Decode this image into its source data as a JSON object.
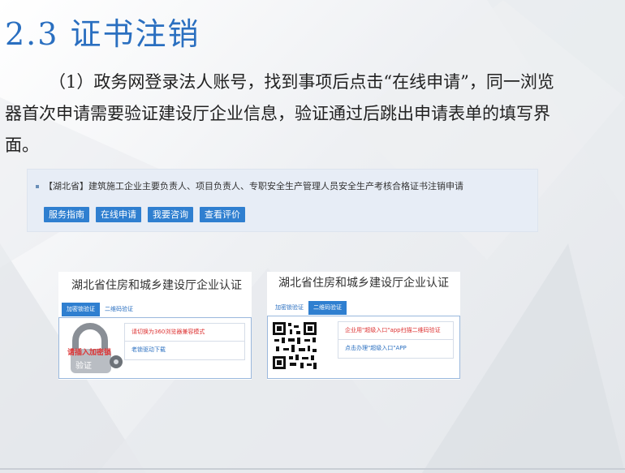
{
  "slide": {
    "title": "2.3 证书注销",
    "paragraph_indent_text": "（1）政务网登录法人账号，找到事项后点击“在线申请",
    "paragraph_rest": "”，同一浏览器首次申请需要验证建设厅企业信息，验证通过后跳出申请表单的填写界面。"
  },
  "panel": {
    "item_title": "【湖北省】建筑施工企业主要负责人、项目负责人、专职安全生产管理人员安全生产考核合格证书注销申请",
    "buttons": [
      "服务指南",
      "在线申请",
      "我要咨询",
      "查看评价"
    ]
  },
  "card_left": {
    "title": "湖北省住房和城乡建设厅企业认证",
    "tabs": [
      "加密锁验证",
      "二维码验证"
    ],
    "active_tab": 0,
    "lock_text_top": "请插入加密锁",
    "lock_text_bottom": "验证",
    "options": [
      "请切换为360浏览器兼容模式",
      "老锁驱动下载"
    ]
  },
  "card_right": {
    "title": "湖北省住房和城乡建设厅企业认证",
    "tabs": [
      "加密锁验证",
      "二维码验证"
    ],
    "active_tab": 1,
    "options": [
      "企业用\"超级入口\"app扫描二维码验证",
      "点击办理\"超级入口\"APP"
    ]
  },
  "colors": {
    "accent": "#2f7fd0",
    "title": "#2a6fc0",
    "warning": "#d33333"
  }
}
